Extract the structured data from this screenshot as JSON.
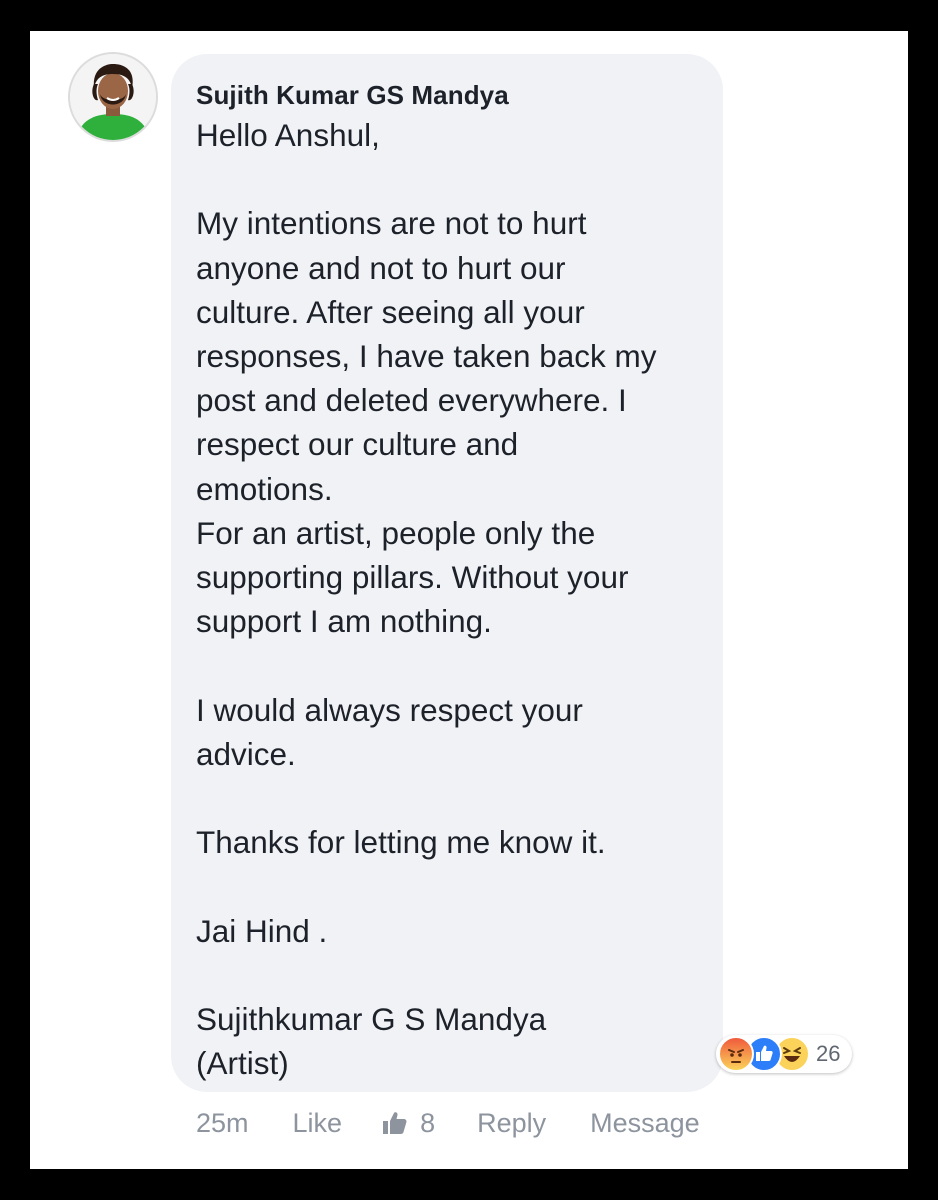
{
  "comment": {
    "author": "Sujith Kumar GS Mandya",
    "body": "Hello Anshul,\n\nMy intentions are not to hurt\nanyone and not to hurt our\nculture. After seeing all your\nresponses, I have taken back my\npost and deleted everywhere. I\nrespect our culture and\nemotions.\nFor an artist, people only the\nsupporting pillars. Without your\nsupport I am nothing.\n\nI would always respect your\nadvice.\n\nThanks for letting me know it.\n\nJai Hind .\n\nSujithkumar G S Mandya\n(Artist)",
    "reactions": {
      "icons": [
        "angry-icon",
        "like-icon",
        "haha-icon"
      ],
      "count": "26"
    }
  },
  "actions": {
    "time": "25m",
    "like_label": "Like",
    "like_count": "8",
    "reply_label": "Reply",
    "message_label": "Message"
  },
  "colors": {
    "bubble_bg": "#f1f2f6",
    "text": "#1d2129",
    "muted": "#8d949e",
    "like_blue": "#2d7ff9",
    "frame_border": "#000000"
  }
}
